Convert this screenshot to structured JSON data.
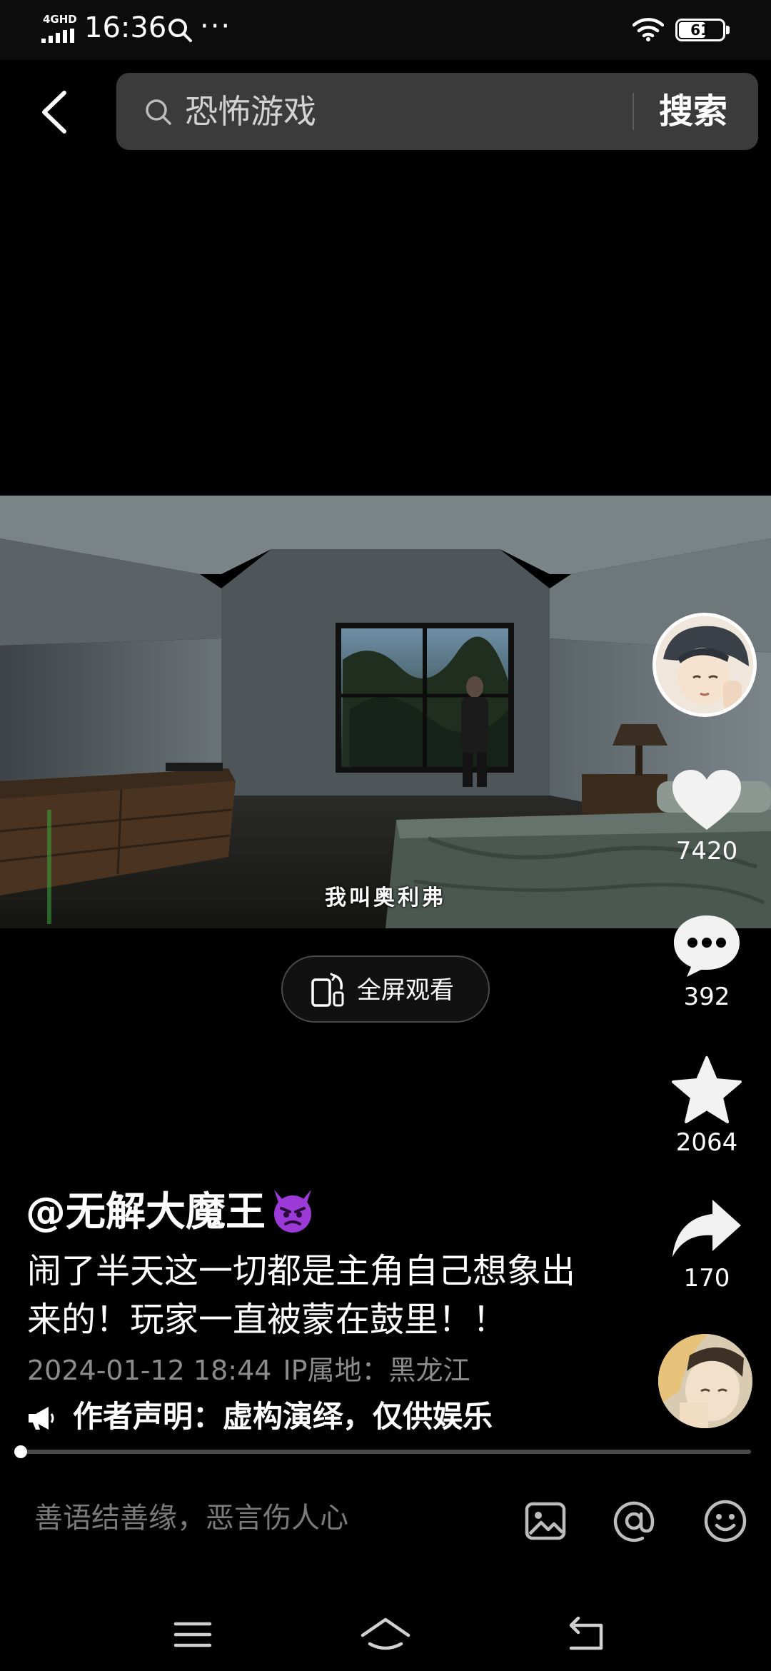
{
  "status_bar": {
    "network": "4GHD",
    "time": "16:36",
    "more": "···",
    "battery": "61",
    "battery_level": 0.61
  },
  "search": {
    "query": "恐怖游戏",
    "button_label": "搜索"
  },
  "video": {
    "subtitle": "我叫奥利弗",
    "fullscreen_label": "全屏观看"
  },
  "rail": {
    "likes": "7420",
    "comments": "392",
    "favorites": "2064",
    "shares": "170"
  },
  "post": {
    "author": "@无解大魔王",
    "description": "闹了半天这一切都是主角自己想象出来的！玩家一直被蒙在鼓里！！",
    "datetime": "2024-01-12 18:44",
    "ip_location": "IP属地：黑龙江",
    "declaration": "作者声明：虚构演绎，仅供娱乐",
    "progress": 0.0
  },
  "comment_bar": {
    "placeholder": "善语结善缘，恶言伤人心"
  },
  "colors": {
    "background": "#000000",
    "search_box": "#3b3b3b",
    "muted_text": "#8c8c8c"
  }
}
